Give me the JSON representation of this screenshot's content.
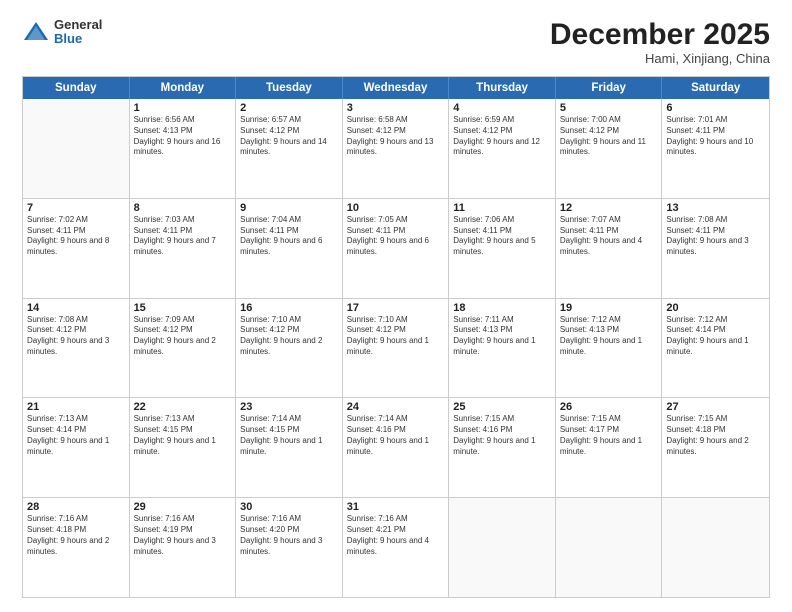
{
  "header": {
    "logo_general": "General",
    "logo_blue": "Blue",
    "month_year": "December 2025",
    "location": "Hami, Xinjiang, China"
  },
  "weekdays": [
    "Sunday",
    "Monday",
    "Tuesday",
    "Wednesday",
    "Thursday",
    "Friday",
    "Saturday"
  ],
  "rows": [
    [
      {
        "day": "",
        "sunrise": "",
        "sunset": "",
        "daylight": ""
      },
      {
        "day": "1",
        "sunrise": "Sunrise: 6:56 AM",
        "sunset": "Sunset: 4:13 PM",
        "daylight": "Daylight: 9 hours and 16 minutes."
      },
      {
        "day": "2",
        "sunrise": "Sunrise: 6:57 AM",
        "sunset": "Sunset: 4:12 PM",
        "daylight": "Daylight: 9 hours and 14 minutes."
      },
      {
        "day": "3",
        "sunrise": "Sunrise: 6:58 AM",
        "sunset": "Sunset: 4:12 PM",
        "daylight": "Daylight: 9 hours and 13 minutes."
      },
      {
        "day": "4",
        "sunrise": "Sunrise: 6:59 AM",
        "sunset": "Sunset: 4:12 PM",
        "daylight": "Daylight: 9 hours and 12 minutes."
      },
      {
        "day": "5",
        "sunrise": "Sunrise: 7:00 AM",
        "sunset": "Sunset: 4:12 PM",
        "daylight": "Daylight: 9 hours and 11 minutes."
      },
      {
        "day": "6",
        "sunrise": "Sunrise: 7:01 AM",
        "sunset": "Sunset: 4:11 PM",
        "daylight": "Daylight: 9 hours and 10 minutes."
      }
    ],
    [
      {
        "day": "7",
        "sunrise": "Sunrise: 7:02 AM",
        "sunset": "Sunset: 4:11 PM",
        "daylight": "Daylight: 9 hours and 8 minutes."
      },
      {
        "day": "8",
        "sunrise": "Sunrise: 7:03 AM",
        "sunset": "Sunset: 4:11 PM",
        "daylight": "Daylight: 9 hours and 7 minutes."
      },
      {
        "day": "9",
        "sunrise": "Sunrise: 7:04 AM",
        "sunset": "Sunset: 4:11 PM",
        "daylight": "Daylight: 9 hours and 6 minutes."
      },
      {
        "day": "10",
        "sunrise": "Sunrise: 7:05 AM",
        "sunset": "Sunset: 4:11 PM",
        "daylight": "Daylight: 9 hours and 6 minutes."
      },
      {
        "day": "11",
        "sunrise": "Sunrise: 7:06 AM",
        "sunset": "Sunset: 4:11 PM",
        "daylight": "Daylight: 9 hours and 5 minutes."
      },
      {
        "day": "12",
        "sunrise": "Sunrise: 7:07 AM",
        "sunset": "Sunset: 4:11 PM",
        "daylight": "Daylight: 9 hours and 4 minutes."
      },
      {
        "day": "13",
        "sunrise": "Sunrise: 7:08 AM",
        "sunset": "Sunset: 4:11 PM",
        "daylight": "Daylight: 9 hours and 3 minutes."
      }
    ],
    [
      {
        "day": "14",
        "sunrise": "Sunrise: 7:08 AM",
        "sunset": "Sunset: 4:12 PM",
        "daylight": "Daylight: 9 hours and 3 minutes."
      },
      {
        "day": "15",
        "sunrise": "Sunrise: 7:09 AM",
        "sunset": "Sunset: 4:12 PM",
        "daylight": "Daylight: 9 hours and 2 minutes."
      },
      {
        "day": "16",
        "sunrise": "Sunrise: 7:10 AM",
        "sunset": "Sunset: 4:12 PM",
        "daylight": "Daylight: 9 hours and 2 minutes."
      },
      {
        "day": "17",
        "sunrise": "Sunrise: 7:10 AM",
        "sunset": "Sunset: 4:12 PM",
        "daylight": "Daylight: 9 hours and 1 minute."
      },
      {
        "day": "18",
        "sunrise": "Sunrise: 7:11 AM",
        "sunset": "Sunset: 4:13 PM",
        "daylight": "Daylight: 9 hours and 1 minute."
      },
      {
        "day": "19",
        "sunrise": "Sunrise: 7:12 AM",
        "sunset": "Sunset: 4:13 PM",
        "daylight": "Daylight: 9 hours and 1 minute."
      },
      {
        "day": "20",
        "sunrise": "Sunrise: 7:12 AM",
        "sunset": "Sunset: 4:14 PM",
        "daylight": "Daylight: 9 hours and 1 minute."
      }
    ],
    [
      {
        "day": "21",
        "sunrise": "Sunrise: 7:13 AM",
        "sunset": "Sunset: 4:14 PM",
        "daylight": "Daylight: 9 hours and 1 minute."
      },
      {
        "day": "22",
        "sunrise": "Sunrise: 7:13 AM",
        "sunset": "Sunset: 4:15 PM",
        "daylight": "Daylight: 9 hours and 1 minute."
      },
      {
        "day": "23",
        "sunrise": "Sunrise: 7:14 AM",
        "sunset": "Sunset: 4:15 PM",
        "daylight": "Daylight: 9 hours and 1 minute."
      },
      {
        "day": "24",
        "sunrise": "Sunrise: 7:14 AM",
        "sunset": "Sunset: 4:16 PM",
        "daylight": "Daylight: 9 hours and 1 minute."
      },
      {
        "day": "25",
        "sunrise": "Sunrise: 7:15 AM",
        "sunset": "Sunset: 4:16 PM",
        "daylight": "Daylight: 9 hours and 1 minute."
      },
      {
        "day": "26",
        "sunrise": "Sunrise: 7:15 AM",
        "sunset": "Sunset: 4:17 PM",
        "daylight": "Daylight: 9 hours and 1 minute."
      },
      {
        "day": "27",
        "sunrise": "Sunrise: 7:15 AM",
        "sunset": "Sunset: 4:18 PM",
        "daylight": "Daylight: 9 hours and 2 minutes."
      }
    ],
    [
      {
        "day": "28",
        "sunrise": "Sunrise: 7:16 AM",
        "sunset": "Sunset: 4:18 PM",
        "daylight": "Daylight: 9 hours and 2 minutes."
      },
      {
        "day": "29",
        "sunrise": "Sunrise: 7:16 AM",
        "sunset": "Sunset: 4:19 PM",
        "daylight": "Daylight: 9 hours and 3 minutes."
      },
      {
        "day": "30",
        "sunrise": "Sunrise: 7:16 AM",
        "sunset": "Sunset: 4:20 PM",
        "daylight": "Daylight: 9 hours and 3 minutes."
      },
      {
        "day": "31",
        "sunrise": "Sunrise: 7:16 AM",
        "sunset": "Sunset: 4:21 PM",
        "daylight": "Daylight: 9 hours and 4 minutes."
      },
      {
        "day": "",
        "sunrise": "",
        "sunset": "",
        "daylight": ""
      },
      {
        "day": "",
        "sunrise": "",
        "sunset": "",
        "daylight": ""
      },
      {
        "day": "",
        "sunrise": "",
        "sunset": "",
        "daylight": ""
      }
    ]
  ]
}
